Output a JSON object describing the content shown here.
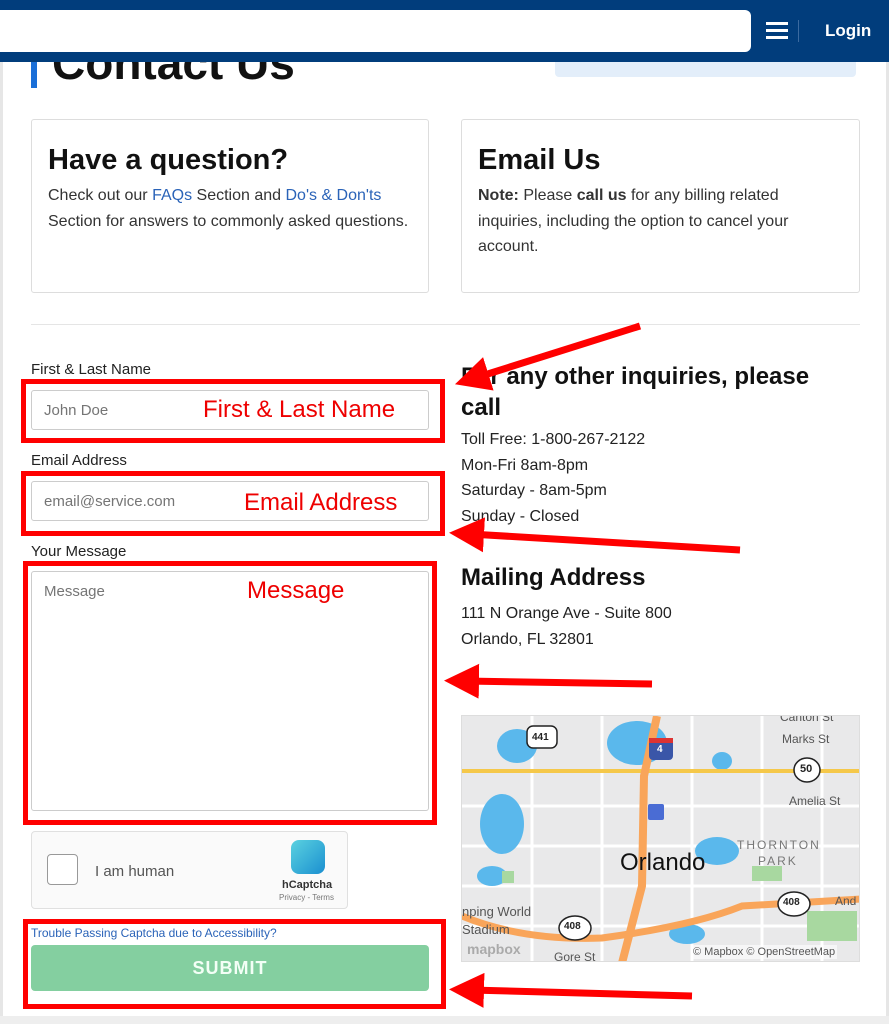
{
  "header": {
    "login_label": "Login",
    "menu_icon": "hamburger-icon"
  },
  "page": {
    "title": "Contact Us"
  },
  "cards": {
    "question": {
      "title": "Have a question?",
      "pre": "Check out our ",
      "faqs_link": "FAQs",
      "mid": " Section and ",
      "dos_link": "Do's & Don'ts",
      "post": " Section for answers to commonly asked questions."
    },
    "email": {
      "title": "Email Us",
      "note_label": "Note:",
      "pre": " Please ",
      "call_us": "call us",
      "post": " for any billing related inquiries, including the option to cancel your account."
    }
  },
  "form": {
    "name_label": "First & Last Name",
    "name_placeholder": "John Doe",
    "email_label": "Email Address",
    "email_placeholder": "email@service.com",
    "message_label": "Your Message",
    "message_placeholder": "Message",
    "captcha": {
      "label": "I am human",
      "brand": "hCaptcha",
      "links": "Privacy - Terms"
    },
    "accessibility_link": "Trouble Passing Captcha due to Accessibility?",
    "submit_label": "SUBMIT"
  },
  "annotations": {
    "name": "First & Last Name",
    "email": "Email Address",
    "message": "Message",
    "color": "#ff0000"
  },
  "contact": {
    "heading": "For any other inquiries, please call",
    "lines": [
      "Toll Free: 1-800-267-2122",
      "Mon-Fri 8am-8pm",
      "Saturday - 8am-5pm",
      "Sunday - Closed"
    ],
    "mailing_heading": "Mailing Address",
    "address": [
      "111 N Orange Ave - Suite 800",
      "Orlando, FL 32801"
    ]
  },
  "map": {
    "city": "Orlando",
    "labels": [
      "Marks St",
      "Amelia St",
      "THORNTON",
      "PARK",
      "nping World",
      "Stadium",
      "Gore St",
      "And",
      "Canton St"
    ],
    "shields": [
      "441",
      "4",
      "50",
      "408",
      "408"
    ],
    "logo": "mapbox",
    "attribution": "© Mapbox © OpenStreetMap"
  }
}
